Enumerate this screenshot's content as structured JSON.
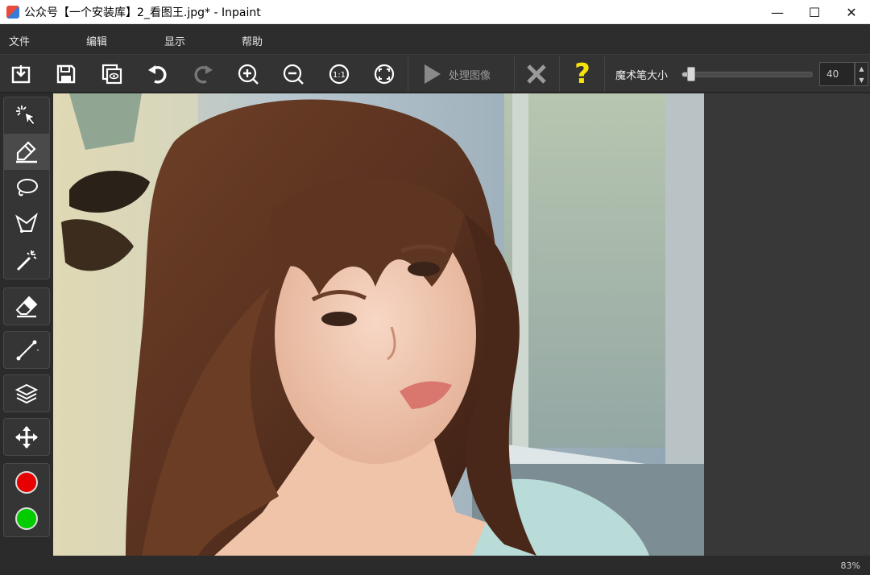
{
  "window": {
    "title": "公众号【一个安装库】2_看图王.jpg* - Inpaint",
    "minimize_glyph": "—",
    "maximize_glyph": "☐",
    "close_glyph": "✕"
  },
  "menu": {
    "items": [
      {
        "label": "文件"
      },
      {
        "label": "编辑"
      },
      {
        "label": "显示"
      },
      {
        "label": "帮助"
      }
    ]
  },
  "toolbar": {
    "buttons": [
      {
        "icon": "open-icon"
      },
      {
        "icon": "save-icon"
      },
      {
        "icon": "preview-icon"
      },
      {
        "icon": "undo-icon"
      },
      {
        "icon": "redo-icon"
      },
      {
        "icon": "zoom-in-icon"
      },
      {
        "icon": "zoom-out-icon"
      },
      {
        "icon": "actual-size-icon"
      },
      {
        "icon": "fit-screen-icon"
      }
    ],
    "process_label": "处理图像",
    "cancel_icon": "x-icon",
    "help_glyph": "?",
    "brush_size_label": "魔术笔大小",
    "brush_size_value": "40",
    "brush_size_fraction": 0.08
  },
  "tools": {
    "groups": [
      [
        "select-icon",
        "marker-icon",
        "lasso-icon",
        "polygon-lasso-icon",
        "magic-wand-icon"
      ],
      [
        "eraser-icon"
      ],
      [
        "line-icon"
      ],
      [
        "layers-icon"
      ],
      [
        "move-icon"
      ]
    ],
    "active_tool": "marker-icon",
    "colors": [
      "#e60000",
      "#00cc00"
    ]
  },
  "status": {
    "zoom": "83%"
  },
  "colors": {
    "accent_help": "#f5e30a",
    "background": "#2b2b2b"
  }
}
